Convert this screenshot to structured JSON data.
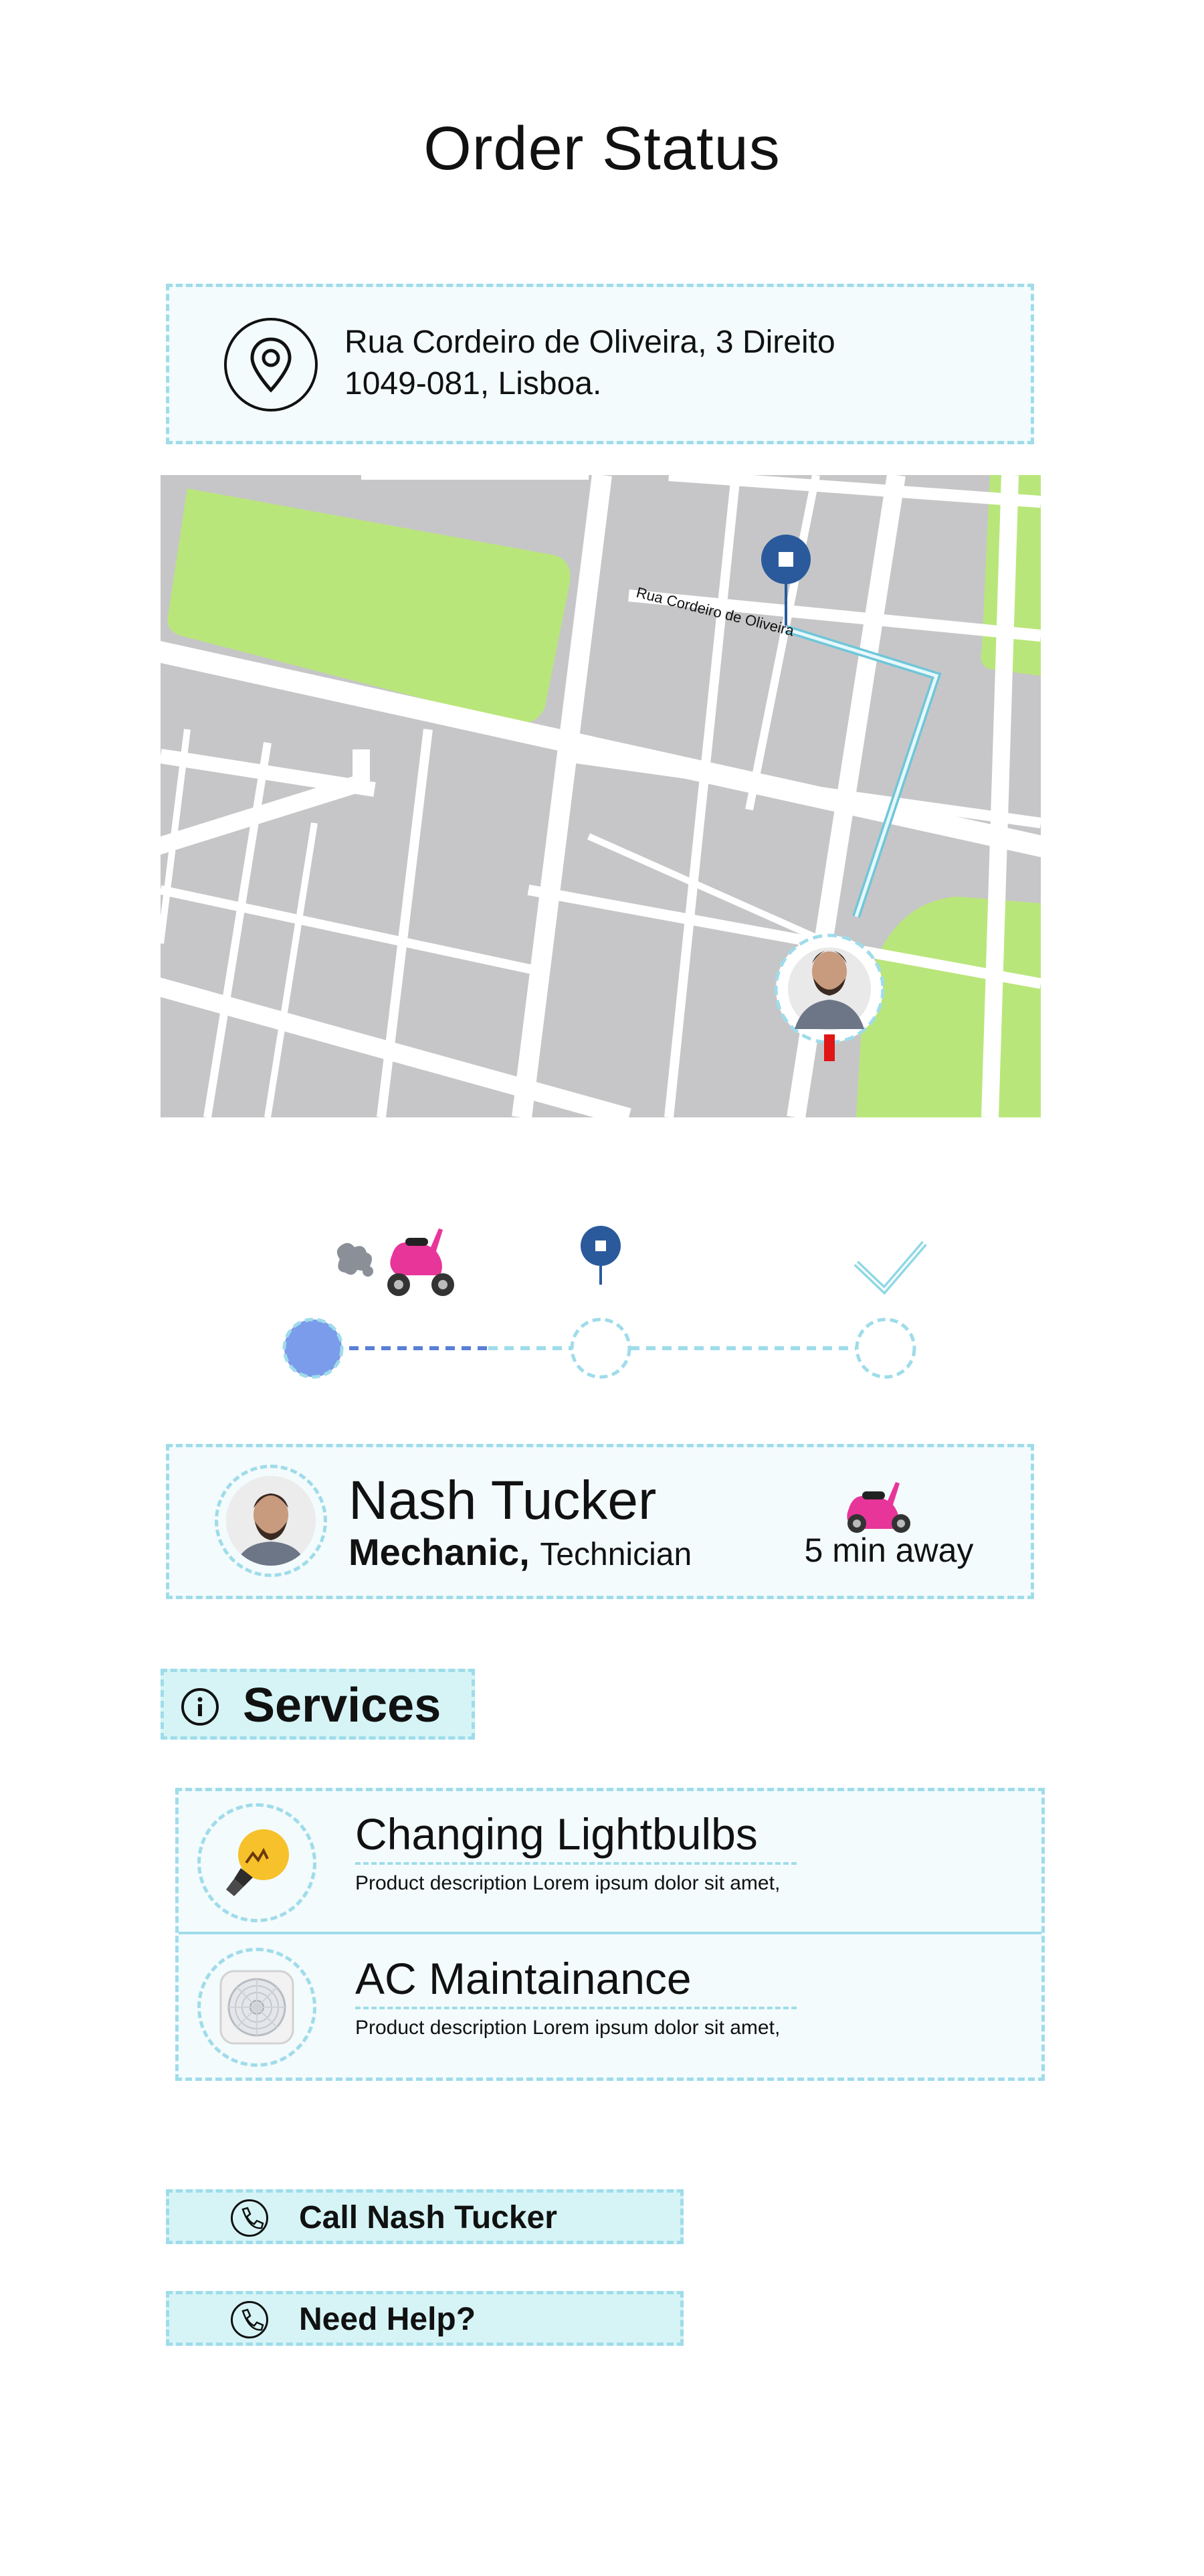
{
  "page": {
    "title": "Order Status"
  },
  "address": {
    "line1": "Rua Cordeiro de Oliveira, 3 Direito",
    "line2": "1049-081, Lisboa.",
    "icon": "location-pin-icon"
  },
  "map": {
    "street_label": "Rua Cordeiro de Oliveira",
    "destination_icon": "destination-marker-icon",
    "technician_icon": "technician-avatar-marker"
  },
  "progress": {
    "steps": [
      "dispatched",
      "destination",
      "completed"
    ],
    "current_step": 1,
    "icons": [
      "scooter-icon",
      "destination-marker-icon",
      "checkmark-icon"
    ]
  },
  "technician": {
    "name": "Nash Tucker",
    "role_primary": "Mechanic,",
    "role_secondary": "Technician",
    "eta": "5 min away",
    "vehicle_icon": "scooter-icon"
  },
  "services": {
    "header": "Services",
    "items": [
      {
        "name": "Changing Lightbulbs",
        "description": "Product description Lorem ipsum dolor sit amet,",
        "icon": "lightbulb-icon"
      },
      {
        "name": "AC Maintainance",
        "description": "Product description Lorem ipsum dolor sit amet,",
        "icon": "fan-icon"
      }
    ]
  },
  "actions": {
    "call_label": "Call Nash Tucker",
    "help_label": "Need Help?"
  },
  "colors": {
    "accent_dash": "#9fdcea",
    "accent_fill": "#d6f4f6",
    "marker_blue": "#2a5a9b",
    "progress_blue": "#7b9cea",
    "park_green": "#b9e67a",
    "scooter_pink": "#e8359a"
  }
}
